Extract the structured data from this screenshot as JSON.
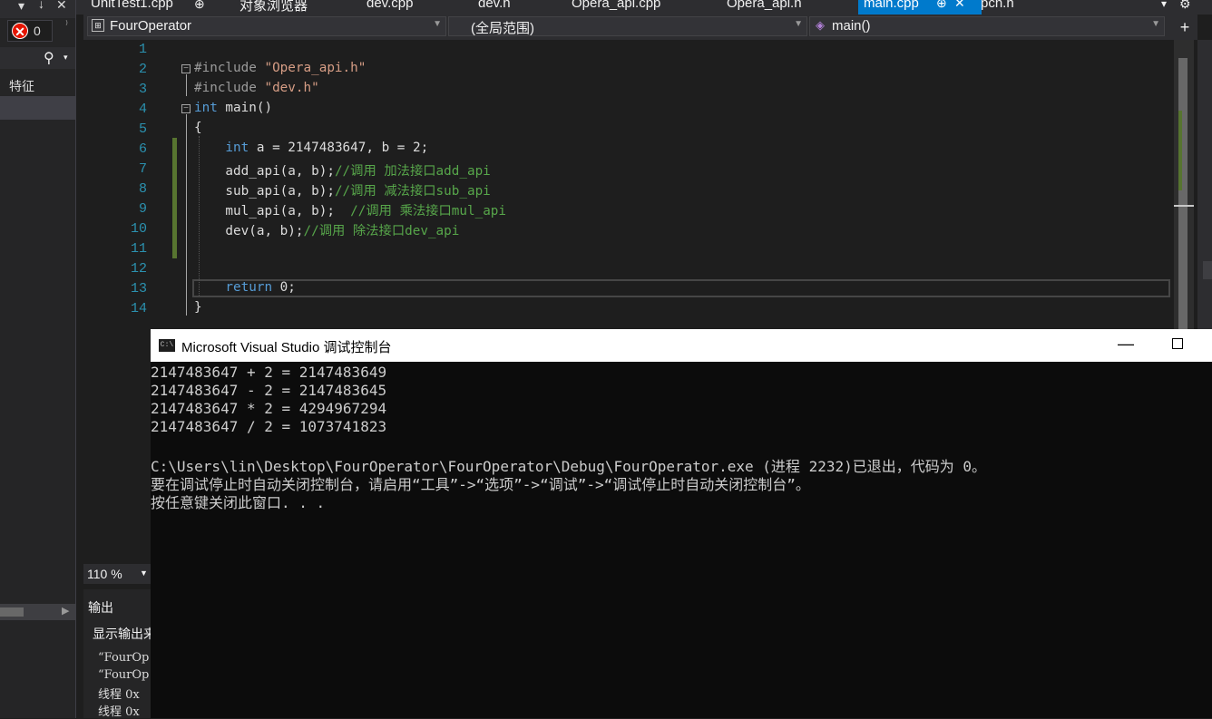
{
  "tabs": [
    "UnitTest1.cpp",
    "对象浏览器",
    "dev.cpp",
    "dev.h",
    "Opera_api.cpp",
    "Opera_api.h",
    "main.cpp",
    "pch.h"
  ],
  "active_tab": "main.cpp",
  "tab_pin_glyph": "⊕",
  "tab_close_glyph": "✕",
  "left_panel": {
    "error_count": "0",
    "header": "特征"
  },
  "navbar": {
    "project": "FourOperator",
    "scope": "(全局范围)",
    "member": "main()"
  },
  "editor": {
    "line_numbers": [
      "1",
      "2",
      "3",
      "4",
      "5",
      "6",
      "7",
      "8",
      "9",
      "10",
      "11",
      "12",
      "13",
      "14"
    ],
    "lines": {
      "l2a": "#include ",
      "l2b": "\"Opera_api.h\"",
      "l3a": "#include ",
      "l3b": "\"dev.h\"",
      "l4a": "int",
      "l4b": " main()",
      "l5": "{",
      "l6a": "    int",
      "l6b": " a = 2147483647, b = 2;",
      "l7a": "    add_api(a, b);",
      "l7b": "//调用 加法接口add_api",
      "l8a": "    sub_api(a, b);",
      "l8b": "//调用 减法接口sub_api",
      "l9a": "    mul_api(a, b);  ",
      "l9b": "//调用 乘法接口mul_api",
      "l10a": "    dev(a, b);",
      "l10b": "//调用 除法接口dev_api",
      "l13a": "    return",
      "l13b": " 0;",
      "l14": "}"
    }
  },
  "zoom": "110 %",
  "output_panel": {
    "title": "输出",
    "show_label": "显示输出来",
    "lines": [
      "“FourOp",
      "“FourOp",
      "线程 0x",
      "线程 0x"
    ]
  },
  "console": {
    "title": "Microsoft Visual Studio 调试控制台",
    "icon_text": "C:\\",
    "lines": [
      "2147483647 + 2 = 2147483649",
      "2147483647 - 2 = 2147483645",
      "2147483647 * 2 = 4294967294",
      "2147483647 / 2 = 1073741823",
      "",
      "C:\\Users\\lin\\Desktop\\FourOperator\\FourOperator\\Debug\\FourOperator.exe (进程 2232)已退出，代码为 0。",
      "要在调试停止时自动关闭控制台，请启用“工具”->“选项”->“调试”->“调试停止时自动关闭控制台”。",
      "按任意键关闭此窗口. . ."
    ]
  },
  "colors": {
    "accent": "#007acc",
    "keyword": "#569cd6",
    "string": "#d69d85",
    "comment": "#57a64a",
    "line_number": "#2b91af"
  }
}
